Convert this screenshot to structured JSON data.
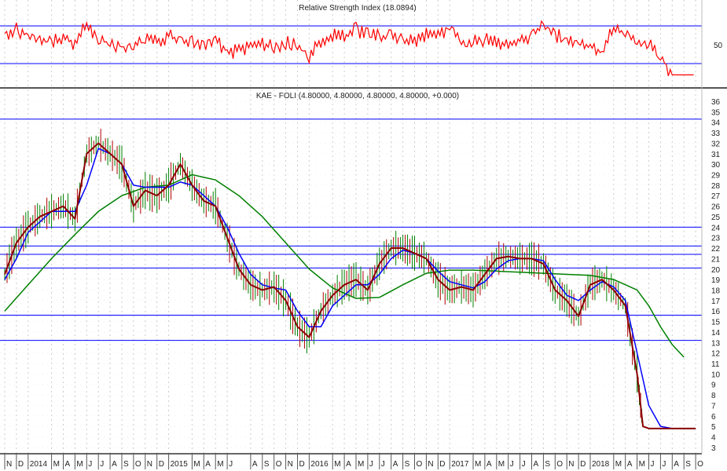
{
  "chart_data": [
    {
      "type": "line",
      "panel": "rsi",
      "title": "Relative Strength Index (18.0894)",
      "ylim": [
        0,
        100
      ],
      "y_ticks": [
        50
      ],
      "reference_levels": [
        70,
        30
      ],
      "colors": {
        "rsi": "#ff0000",
        "levels": "#0000ff"
      },
      "series": [
        {
          "name": "RSI",
          "x": [
            0,
            1,
            2,
            3,
            4,
            5,
            6,
            7,
            8,
            9,
            10,
            11,
            12,
            13,
            14,
            15,
            16,
            17,
            18,
            19,
            20,
            21,
            22,
            23,
            24,
            25,
            26,
            27,
            28,
            29,
            30,
            31,
            32,
            33,
            34,
            35,
            36,
            37,
            38,
            39,
            40,
            41,
            42,
            43,
            44,
            45,
            46,
            47,
            48,
            49,
            50,
            51,
            52,
            53,
            54,
            55,
            56,
            57,
            58
          ],
          "values": [
            62,
            66,
            60,
            55,
            52,
            58,
            50,
            72,
            56,
            52,
            48,
            46,
            58,
            52,
            60,
            55,
            52,
            50,
            54,
            42,
            44,
            48,
            52,
            46,
            52,
            50,
            35,
            55,
            60,
            58,
            66,
            62,
            58,
            62,
            55,
            54,
            60,
            58,
            70,
            52,
            54,
            56,
            52,
            52,
            56,
            58,
            70,
            60,
            56,
            50,
            48,
            42,
            70,
            62,
            55,
            50,
            38,
            18,
            18
          ]
        }
      ]
    },
    {
      "type": "line",
      "panel": "price",
      "title": "KAE - FOLI (4.80000, 4.80000, 4.80000, 4.80000, +0.000)",
      "ylim": [
        3,
        36
      ],
      "y_ticks": [
        3,
        4,
        5,
        6,
        7,
        8,
        9,
        10,
        11,
        12,
        13,
        14,
        15,
        16,
        17,
        18,
        19,
        20,
        21,
        22,
        23,
        24,
        25,
        26,
        27,
        28,
        29,
        30,
        31,
        32,
        33,
        34,
        35,
        36
      ],
      "horizontal_lines": [
        34.3,
        24.0,
        22.2,
        21.4,
        20.1,
        15.6,
        13.2
      ],
      "x_labels": [
        {
          "i": 0,
          "t": "N"
        },
        {
          "i": 1,
          "t": "D"
        },
        {
          "i": 2,
          "t": "2014"
        },
        {
          "i": 4,
          "t": "M"
        },
        {
          "i": 5,
          "t": "A"
        },
        {
          "i": 6,
          "t": "M"
        },
        {
          "i": 7,
          "t": "J"
        },
        {
          "i": 8,
          "t": "J"
        },
        {
          "i": 9,
          "t": "A"
        },
        {
          "i": 10,
          "t": "S"
        },
        {
          "i": 11,
          "t": "O"
        },
        {
          "i": 12,
          "t": "N"
        },
        {
          "i": 13,
          "t": "D"
        },
        {
          "i": 14,
          "t": "2015"
        },
        {
          "i": 16,
          "t": "M"
        },
        {
          "i": 17,
          "t": "A"
        },
        {
          "i": 18,
          "t": "M"
        },
        {
          "i": 19,
          "t": "J"
        },
        {
          "i": 21,
          "t": "A"
        },
        {
          "i": 22,
          "t": "S"
        },
        {
          "i": 23,
          "t": "O"
        },
        {
          "i": 24,
          "t": "N"
        },
        {
          "i": 25,
          "t": "D"
        },
        {
          "i": 26,
          "t": "2016"
        },
        {
          "i": 28,
          "t": "M"
        },
        {
          "i": 29,
          "t": "A"
        },
        {
          "i": 30,
          "t": "M"
        },
        {
          "i": 31,
          "t": "J"
        },
        {
          "i": 32,
          "t": "J"
        },
        {
          "i": 33,
          "t": "A"
        },
        {
          "i": 34,
          "t": "S"
        },
        {
          "i": 35,
          "t": "O"
        },
        {
          "i": 36,
          "t": "N"
        },
        {
          "i": 37,
          "t": "D"
        },
        {
          "i": 38,
          "t": "2017"
        },
        {
          "i": 40,
          "t": "M"
        },
        {
          "i": 41,
          "t": "A"
        },
        {
          "i": 42,
          "t": "M"
        },
        {
          "i": 43,
          "t": "J"
        },
        {
          "i": 44,
          "t": "J"
        },
        {
          "i": 45,
          "t": "A"
        },
        {
          "i": 46,
          "t": "S"
        },
        {
          "i": 47,
          "t": "O"
        },
        {
          "i": 48,
          "t": "N"
        },
        {
          "i": 49,
          "t": "D"
        },
        {
          "i": 50,
          "t": "2018"
        },
        {
          "i": 52,
          "t": "M"
        },
        {
          "i": 53,
          "t": "A"
        },
        {
          "i": 54,
          "t": "M"
        },
        {
          "i": 55,
          "t": "J"
        },
        {
          "i": 56,
          "t": "J"
        },
        {
          "i": 57,
          "t": "A"
        },
        {
          "i": 58,
          "t": "S"
        },
        {
          "i": 59,
          "t": "O"
        }
      ],
      "colors": {
        "price": "#8b0000",
        "ma_short": "#0000ff",
        "ma_long": "#008000",
        "levels": "#0000ff"
      },
      "series": [
        {
          "name": "Price",
          "x": [
            0,
            1,
            2,
            3,
            4,
            5,
            6,
            7,
            8,
            9,
            10,
            11,
            12,
            13,
            14,
            15,
            16,
            17,
            18,
            19,
            20,
            21,
            22,
            23,
            24,
            25,
            26,
            27,
            28,
            29,
            30,
            31,
            32,
            33,
            34,
            35,
            36,
            37,
            38,
            39,
            40,
            41,
            42,
            43,
            44,
            45,
            46,
            47,
            48,
            49,
            50,
            51,
            52,
            53,
            54,
            54.5,
            55,
            56,
            57,
            58,
            59
          ],
          "values": [
            19.5,
            22.5,
            24,
            25,
            25.5,
            26,
            24.8,
            31,
            32,
            31,
            30,
            26,
            27.5,
            27,
            28,
            30,
            28,
            26.5,
            26,
            23,
            20,
            18.5,
            18,
            18.3,
            17,
            14.5,
            13.5,
            16,
            17.5,
            18.5,
            19,
            18,
            20.5,
            22,
            22,
            21.5,
            21,
            19,
            18,
            18.3,
            18,
            19.5,
            21,
            21.2,
            21,
            21,
            20.5,
            18,
            17,
            15.5,
            18.5,
            19,
            18,
            16.5,
            10,
            5,
            4.8,
            4.8,
            4.8,
            4.8,
            4.8
          ]
        },
        {
          "name": "MA short",
          "x": [
            0,
            1,
            2,
            3,
            4,
            5,
            6,
            7,
            8,
            9,
            10,
            11,
            12,
            13,
            14,
            15,
            16,
            17,
            18,
            19,
            20,
            21,
            22,
            23,
            24,
            25,
            26,
            27,
            28,
            29,
            30,
            31,
            32,
            33,
            34,
            35,
            36,
            37,
            38,
            39,
            40,
            41,
            42,
            43,
            44,
            45,
            46,
            47,
            48,
            49,
            50,
            51,
            52,
            53,
            54,
            55,
            56,
            57,
            58,
            59
          ],
          "values": [
            19,
            21,
            23.5,
            24.5,
            25.5,
            25.5,
            25.5,
            28,
            31.5,
            31,
            30,
            28,
            27.8,
            27.8,
            27.8,
            28.3,
            28,
            27,
            26,
            24,
            21.5,
            19.5,
            18.5,
            18.2,
            18,
            16,
            14.5,
            14.5,
            16.5,
            17.5,
            18.5,
            18.5,
            19.5,
            21,
            21.8,
            21.5,
            21,
            19.8,
            18.8,
            18.5,
            18.2,
            18.8,
            20,
            20.8,
            21,
            21,
            20.8,
            19,
            17.5,
            17,
            18,
            18.8,
            18.3,
            17,
            12,
            7,
            5,
            4.8,
            4.8,
            4.8
          ]
        },
        {
          "name": "MA long",
          "x": [
            0,
            2,
            4,
            6,
            8,
            10,
            12,
            14,
            16,
            18,
            20,
            22,
            24,
            26,
            28,
            30,
            32,
            34,
            36,
            38,
            40,
            42,
            44,
            46,
            48,
            50,
            52,
            54,
            55,
            56,
            57,
            58
          ],
          "values": [
            16,
            18.5,
            21,
            23.3,
            25.5,
            27,
            27.8,
            28,
            29,
            28.5,
            27,
            25,
            22.5,
            20,
            18.2,
            17.2,
            17.3,
            18.5,
            19.6,
            19.9,
            19.9,
            19.8,
            19.7,
            19.6,
            19.5,
            19.4,
            19,
            18,
            16.5,
            14.5,
            12.8,
            11.6
          ]
        }
      ]
    }
  ]
}
